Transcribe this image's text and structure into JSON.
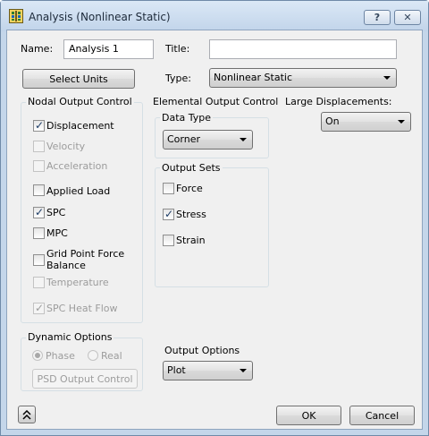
{
  "window": {
    "title": "Analysis (Nonlinear Static)",
    "help_label": "?",
    "close_label": "✕"
  },
  "name_label": "Name:",
  "name_value": "Analysis 1",
  "title_label": "Title:",
  "title_value": "",
  "select_units_label": "Select Units",
  "type_label": "Type:",
  "type_value": "Nonlinear Static",
  "nodal": {
    "group_label": "Nodal Output Control",
    "items": [
      {
        "label": "Displacement",
        "checked": true,
        "enabled": true
      },
      {
        "label": "Velocity",
        "checked": false,
        "enabled": false
      },
      {
        "label": "Acceleration",
        "checked": false,
        "enabled": false
      },
      {
        "label": "Applied Load",
        "checked": false,
        "enabled": true
      },
      {
        "label": "SPC",
        "checked": true,
        "enabled": true
      },
      {
        "label": "MPC",
        "checked": false,
        "enabled": true
      },
      {
        "label": "Grid Point Force",
        "label2": "Balance",
        "checked": false,
        "enabled": true
      },
      {
        "label": "Temperature",
        "checked": false,
        "enabled": false
      },
      {
        "label": "SPC Heat Flow",
        "checked": true,
        "enabled": false
      }
    ]
  },
  "elemental": {
    "group_label": "Elemental Output Control",
    "data_type_label": "Data Type",
    "data_type_value": "Corner",
    "output_sets_label": "Output Sets",
    "sets": [
      {
        "label": "Force",
        "checked": false
      },
      {
        "label": "Stress",
        "checked": true
      },
      {
        "label": "Strain",
        "checked": false
      }
    ]
  },
  "large_disp": {
    "label": "Large Displacements:",
    "value": "On"
  },
  "dynamic": {
    "group_label": "Dynamic Options",
    "phase_label": "Phase",
    "real_label": "Real",
    "psd_label": "PSD Output Control"
  },
  "output_options": {
    "label": "Output Options",
    "value": "Plot"
  },
  "ok_label": "OK",
  "cancel_label": "Cancel",
  "colors": {
    "titlebar": "#c4d6ea",
    "client": "#f0f0f0",
    "check": "#1d3c66"
  }
}
